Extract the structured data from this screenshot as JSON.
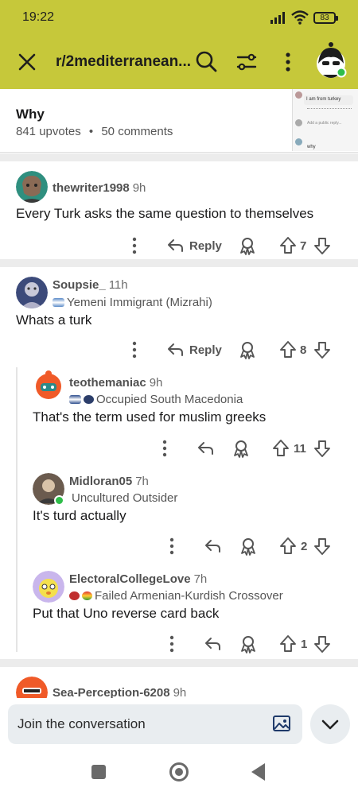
{
  "status": {
    "time": "19:22",
    "battery": "83"
  },
  "header": {
    "subreddit": "r/2mediterranean..."
  },
  "post": {
    "title": "Why",
    "upvotes": "841 upvotes",
    "comments": "50 comments",
    "thumb_lines": [
      "I am from turkey",
      "Add a public reply...",
      "why"
    ]
  },
  "actions": {
    "reply_label": "Reply"
  },
  "comments": [
    {
      "user": "thewriter1998",
      "age": "9h",
      "flair": "",
      "body": "Every Turk asks the same question to themselves",
      "votes": "7"
    },
    {
      "user": "Soupsie_",
      "age": "11h",
      "flair": "Yemeni Immigrant (Mizrahi)",
      "body": "Whats a turk",
      "votes": "8"
    },
    {
      "user": "teothemaniac",
      "age": "9h",
      "flair": "Occupied South Macedonia",
      "body": "That's the term used for muslim greeks",
      "votes": "11"
    },
    {
      "user": "Midloran05",
      "age": "7h",
      "flair": "Uncultured Outsider",
      "body": "It's turd actually",
      "votes": "2"
    },
    {
      "user": "ElectoralCollegeLove",
      "age": "7h",
      "flair": "Failed Armenian-Kurdish Crossover",
      "body": "Put that Uno reverse card back",
      "votes": "1"
    },
    {
      "user": "Sea-Perception-6208",
      "age": "9h"
    }
  ],
  "composer": {
    "placeholder": "Join the conversation"
  }
}
